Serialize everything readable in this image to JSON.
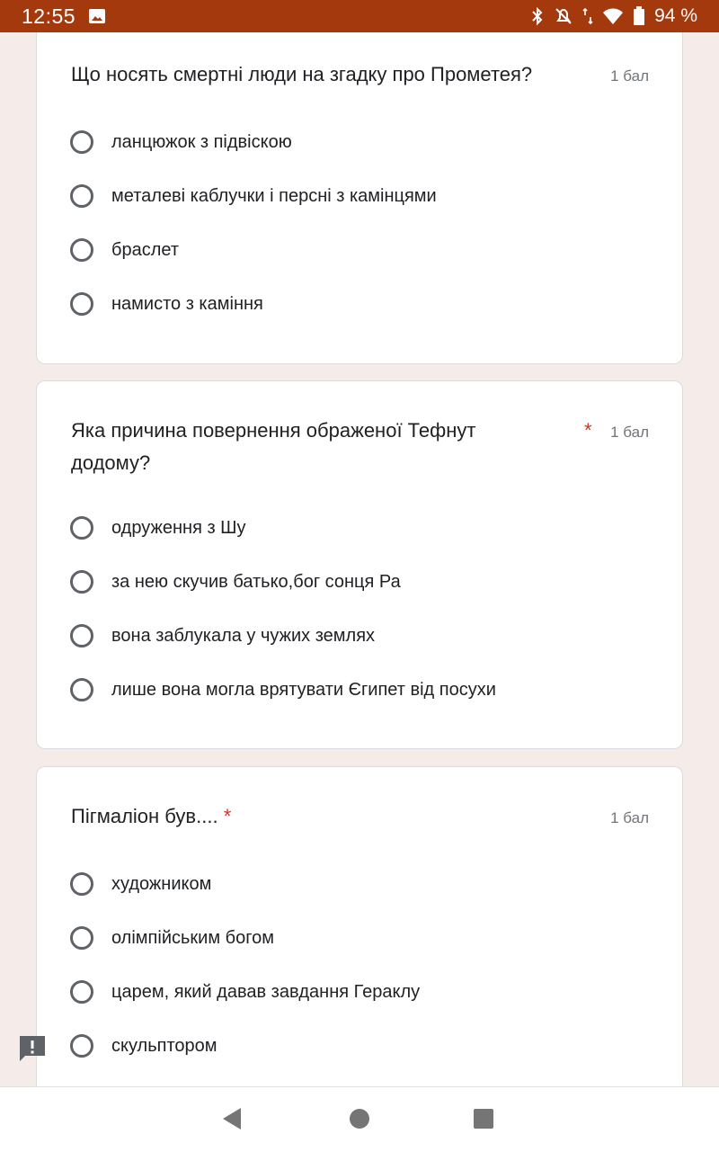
{
  "status": {
    "time": "12:55",
    "battery": "94 %",
    "icons": [
      "image-icon",
      "bluetooth-icon",
      "muted-bell-icon",
      "data-arrows-icon",
      "wifi-icon",
      "battery-icon"
    ]
  },
  "questions": [
    {
      "title": "Що носять смертні люди на згадку про Прометея?",
      "points": "1 бал",
      "required": "",
      "options": [
        "ланцюжок з підвіскою",
        "металеві каблучки і персні з камінцями",
        "браслет",
        "намисто з каміння"
      ]
    },
    {
      "title_line1": "Яка причина повернення ображеної Тефнут",
      "title_line2": "додому?",
      "points": "1 бал",
      "required": "*",
      "options": [
        "одруження з Шу",
        "за нею скучив батько,бог сонця Ра",
        "вона заблукала у чужих землях",
        "лише вона могла врятувати Єгипет від посухи"
      ]
    },
    {
      "title": "Пігмаліон був....",
      "points": "1 бал",
      "required": "*",
      "options": [
        "художником",
        "олімпійським богом",
        "царем, який давав завдання Гераклу",
        "скульптором"
      ]
    }
  ],
  "colors": {
    "status_bar": "#a5390e",
    "background": "#f5ebe8",
    "required": "#d93025"
  },
  "navigation": {
    "buttons": [
      "back-icon",
      "home-icon",
      "recents-icon"
    ]
  }
}
